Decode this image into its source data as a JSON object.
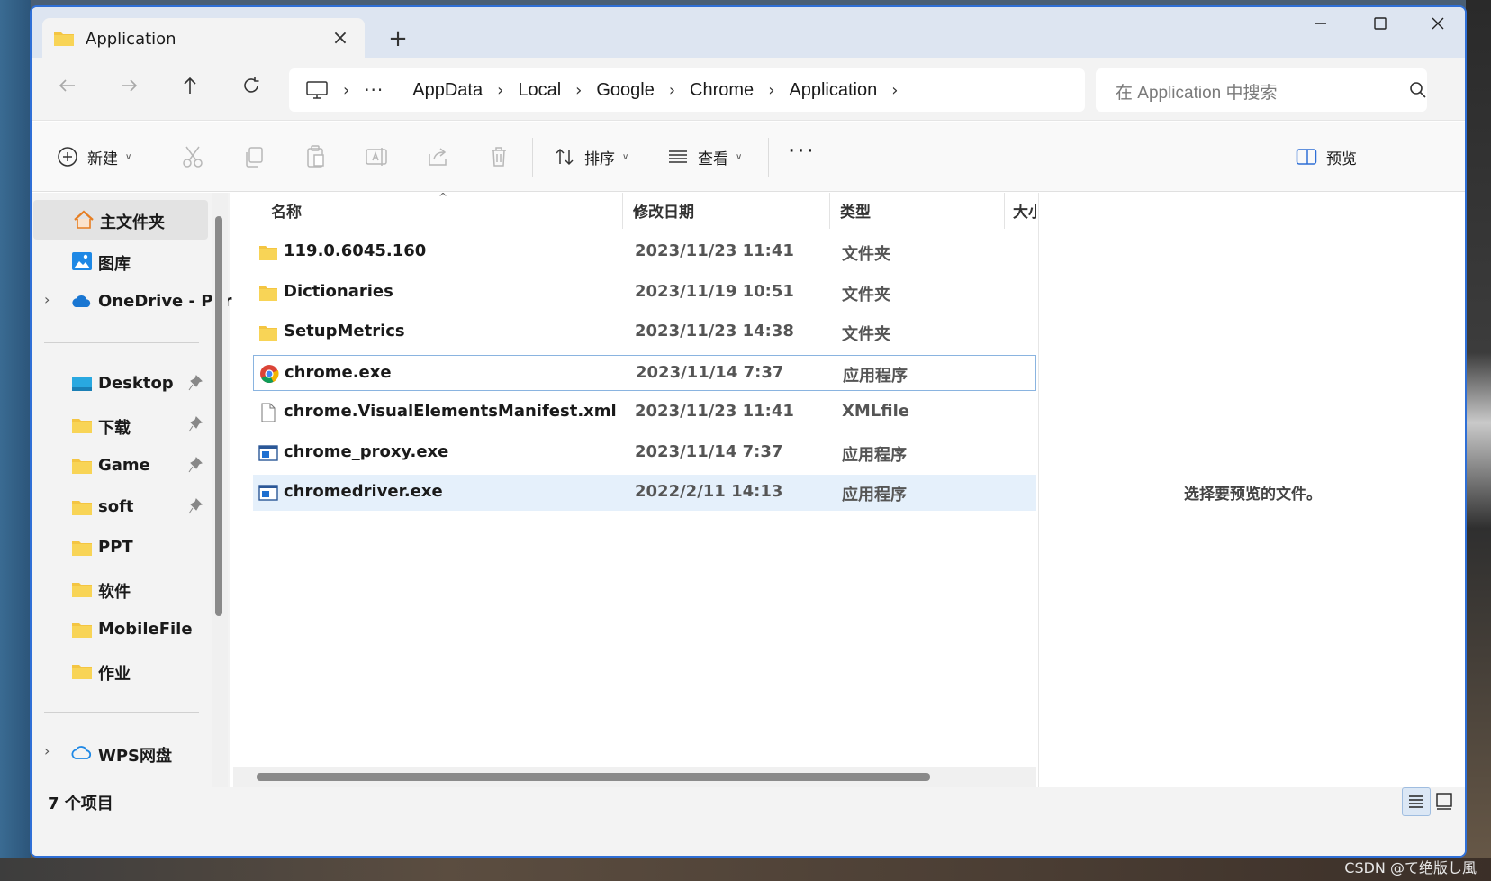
{
  "window": {
    "tab_title": "Application",
    "new_tab_label": "+",
    "close_tab_label": "×"
  },
  "address": {
    "breadcrumb": [
      "AppData",
      "Local",
      "Google",
      "Chrome",
      "Application"
    ],
    "overflow_label": "···",
    "search_placeholder": "在 Application 中搜索"
  },
  "toolbar": {
    "new_label": "新建",
    "sort_label": "排序",
    "view_label": "查看",
    "more_label": "···",
    "preview_label": "预览"
  },
  "sidebar": {
    "items": [
      {
        "label": "主文件夹",
        "icon": "home-icon"
      },
      {
        "label": "图库",
        "icon": "gallery-icon"
      },
      {
        "label": "OneDrive - Per",
        "icon": "onedrive-cloud-icon"
      },
      {
        "label": "Desktop",
        "icon": "desktop-icon"
      },
      {
        "label": "下载",
        "icon": "folder-icon"
      },
      {
        "label": "Game",
        "icon": "folder-icon"
      },
      {
        "label": "soft",
        "icon": "folder-icon"
      },
      {
        "label": "PPT",
        "icon": "folder-icon"
      },
      {
        "label": "软件",
        "icon": "folder-icon"
      },
      {
        "label": "MobileFile",
        "icon": "folder-icon"
      },
      {
        "label": "作业",
        "icon": "folder-icon"
      },
      {
        "label": "WPS网盘",
        "icon": "wps-cloud-icon"
      }
    ]
  },
  "columns": {
    "name": "名称",
    "date": "修改日期",
    "type": "类型",
    "size": "大小"
  },
  "files": [
    {
      "name": "119.0.6045.160",
      "date": "2023/11/23 11:41",
      "type": "文件夹",
      "icon": "folder-icon"
    },
    {
      "name": "Dictionaries",
      "date": "2023/11/19 10:51",
      "type": "文件夹",
      "icon": "folder-icon"
    },
    {
      "name": "SetupMetrics",
      "date": "2023/11/23 14:38",
      "type": "文件夹",
      "icon": "folder-icon"
    },
    {
      "name": "chrome.exe",
      "date": "2023/11/14 7:37",
      "type": "应用程序",
      "icon": "chrome-icon"
    },
    {
      "name": "chrome.VisualElementsManifest.xml",
      "date": "2023/11/23 11:41",
      "type": "XMLfile",
      "icon": "xml-file-icon"
    },
    {
      "name": "chrome_proxy.exe",
      "date": "2023/11/14 7:37",
      "type": "应用程序",
      "icon": "exe-icon"
    },
    {
      "name": "chromedriver.exe",
      "date": "2022/2/11 14:13",
      "type": "应用程序",
      "icon": "exe-icon"
    }
  ],
  "preview": {
    "message": "选择要预览的文件。"
  },
  "status": {
    "count": "7 个项目"
  },
  "watermark": "CSDN @て绝版し風",
  "colors": {
    "accent": "#2f6fd6",
    "folder": "#f4c542",
    "selected_row": "#e5f0fb"
  }
}
